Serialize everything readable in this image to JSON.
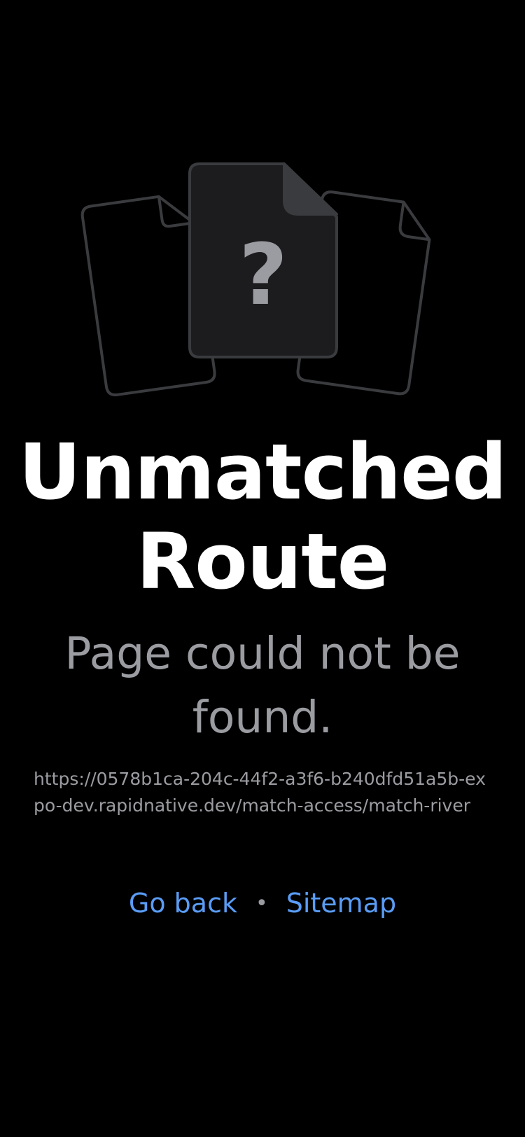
{
  "illustration": {
    "icon": "question-mark-icon",
    "glyph": "?",
    "stroke_color": "#3a3b3e",
    "fill_color": "#1c1c1e",
    "glyph_color": "#9b9ca1"
  },
  "title": "Unmatched Route",
  "subtitle": "Page could not be found.",
  "url": "https://0578b1ca-204c-44f2-a3f6-b240dfd51a5b-expo-dev.rapidnative.dev/match-access/match-river",
  "links": {
    "go_back": "Go back",
    "separator": "•",
    "sitemap": "Sitemap"
  },
  "colors": {
    "background": "#000000",
    "title": "#ffffff",
    "muted": "#9b9ca1",
    "link": "#5a9cf5"
  }
}
